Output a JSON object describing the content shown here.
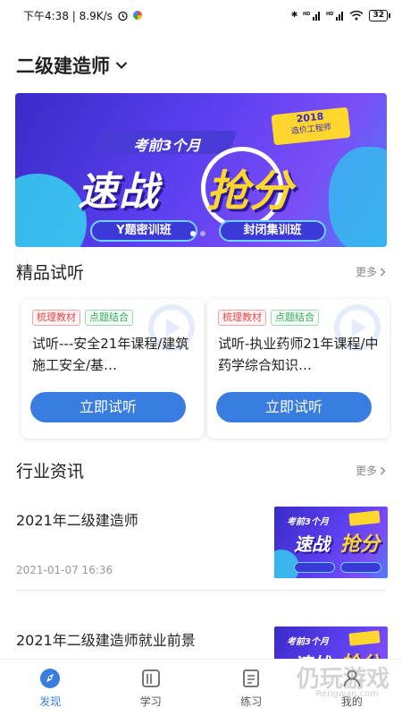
{
  "status_bar": {
    "time_speed": "下午4:38 | 8.9K/s",
    "battery": "32"
  },
  "header": {
    "title": "二级建造师"
  },
  "banner": {
    "headline_top": "考前3个月",
    "headline_main": "速战",
    "headline_accent": "抢分",
    "year_line1": "2018",
    "year_line2": "造价工程师",
    "pill_left": "Y题密训班",
    "pill_right": "封闭集训班"
  },
  "trial_section": {
    "title": "精品试听",
    "more": "更多",
    "cards": [
      {
        "tags": [
          "梳理教材",
          "点题结合"
        ],
        "title": "试听---安全21年课程/建筑施工安全/基…",
        "button": "立即试听"
      },
      {
        "tags": [
          "梳理教材",
          "点题结合"
        ],
        "title": "试听-执业药师21年课程/中药学综合知识…",
        "button": "立即试听"
      }
    ]
  },
  "news_section": {
    "title": "行业资讯",
    "more": "更多",
    "items": [
      {
        "title": "2021年二级建造师",
        "date": "2021-01-07 16:36",
        "thumb_top": "考前3个月",
        "thumb_main": "速战",
        "thumb_accent": "抢分"
      },
      {
        "title": "2021年二级建造师就业前景",
        "thumb_top": "考前3个月",
        "thumb_main": "速战",
        "thumb_accent": "抢分"
      }
    ]
  },
  "tabbar": {
    "tabs": [
      {
        "label": "发现",
        "icon": "compass-icon",
        "active": true
      },
      {
        "label": "学习",
        "icon": "book-icon",
        "active": false
      },
      {
        "label": "练习",
        "icon": "exercise-icon",
        "active": false
      },
      {
        "label": "我的",
        "icon": "profile-icon",
        "active": false
      }
    ]
  },
  "watermark": {
    "text": "仍玩游戏",
    "sub": "Rengwan.com"
  },
  "colors": {
    "accent": "#3a7de0",
    "banner_purple": "#5b3ff0",
    "banner_yellow": "#ffd62e"
  }
}
